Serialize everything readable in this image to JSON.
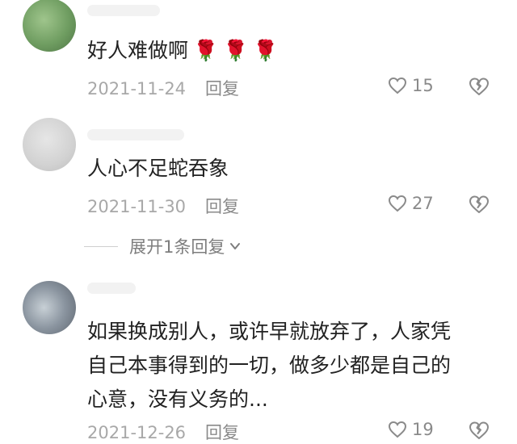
{
  "comments": [
    {
      "text": "好人难做啊",
      "emoji": "🌹🌹🌹",
      "date": "2021-11-24",
      "reply_label": "回复",
      "likes": "15"
    },
    {
      "text": "人心不足蛇吞象",
      "date": "2021-11-30",
      "reply_label": "回复",
      "likes": "27"
    },
    {
      "text_lines": [
        "如果换成别人，或许早就放弃了，人家凭",
        "自己本事得到的一切，做多少都是自己的",
        "心意，没有义务的..."
      ],
      "date": "2021-12-26",
      "reply_label": "回复",
      "likes": "19"
    }
  ],
  "expand_replies_label": "展开1条回复",
  "icons": {
    "like": "heart-outline-icon",
    "dislike": "broken-heart-icon",
    "expand": "chevron-down-icon"
  },
  "colors": {
    "meta_text": "#a8a8a8",
    "body_text": "#222222"
  }
}
